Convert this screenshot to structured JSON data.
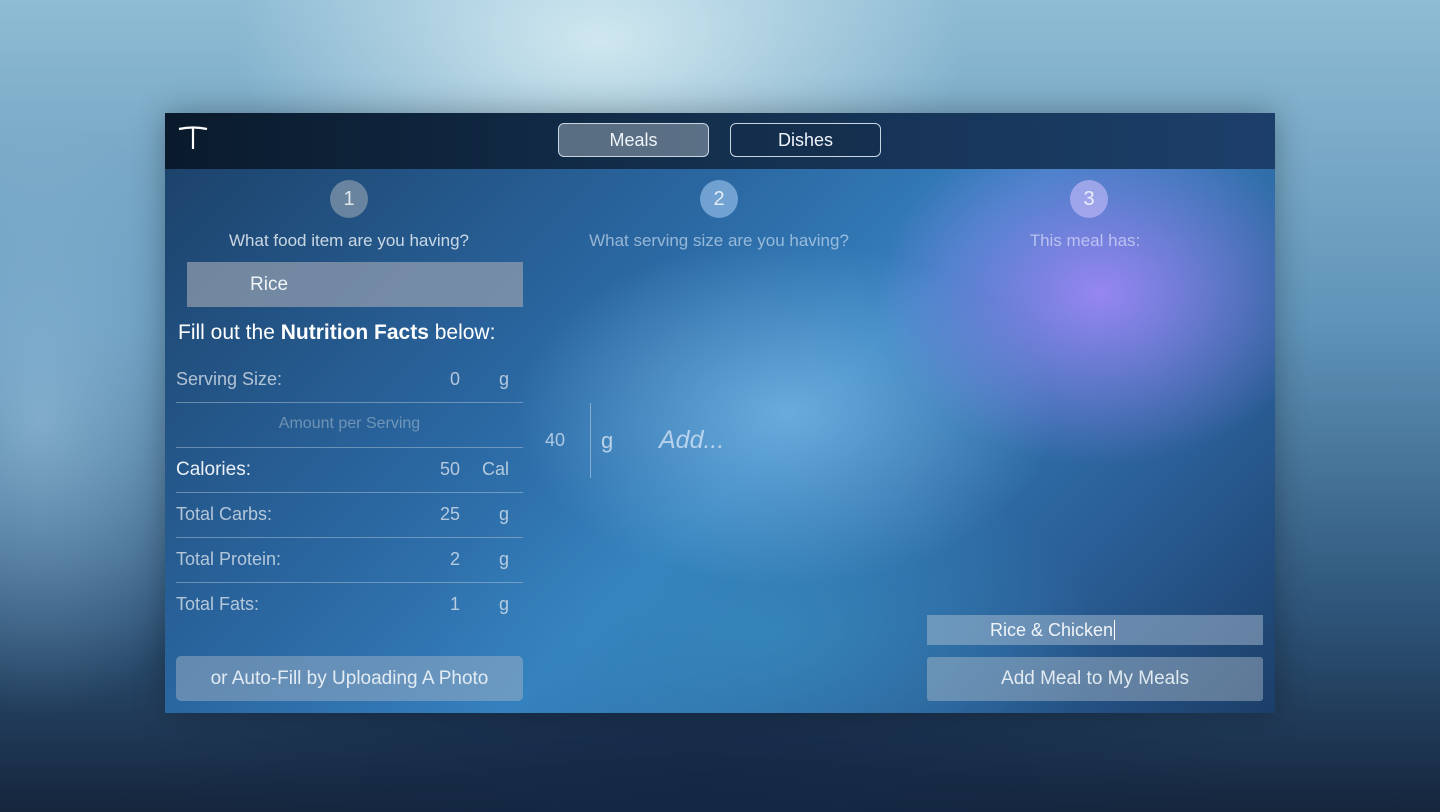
{
  "header": {
    "logo_icon": "t-logo-icon",
    "tabs": [
      {
        "label": "Meals",
        "selected": true
      },
      {
        "label": "Dishes",
        "selected": false
      }
    ]
  },
  "steps": [
    {
      "number": "1",
      "label": "What food item are you having?"
    },
    {
      "number": "2",
      "label": "What serving size are you having?"
    },
    {
      "number": "3",
      "label": "This meal has:"
    }
  ],
  "food_item": {
    "value": "Rice"
  },
  "nutrition": {
    "heading_prefix": "Fill out the ",
    "heading_bold": "Nutrition Facts",
    "heading_suffix": " below:",
    "serving_size": {
      "label": "Serving Size:",
      "value": "0",
      "unit": "g"
    },
    "amount_per_serving": "Amount per Serving",
    "calories": {
      "label": "Calories:",
      "value": "50",
      "unit": "Cal"
    },
    "carbs": {
      "label": "Total Carbs:",
      "value": "25",
      "unit": "g"
    },
    "protein": {
      "label": "Total Protein:",
      "value": "2",
      "unit": "g"
    },
    "fats": {
      "label": "Total Fats:",
      "value": "1",
      "unit": "g"
    }
  },
  "autofill_label": "or Auto-Fill by Uploading A Photo",
  "serving": {
    "amount": "40",
    "unit": "g",
    "add_label": "Add..."
  },
  "meal": {
    "name": "Rice & Chicken",
    "add_button": "Add Meal to My Meals"
  }
}
